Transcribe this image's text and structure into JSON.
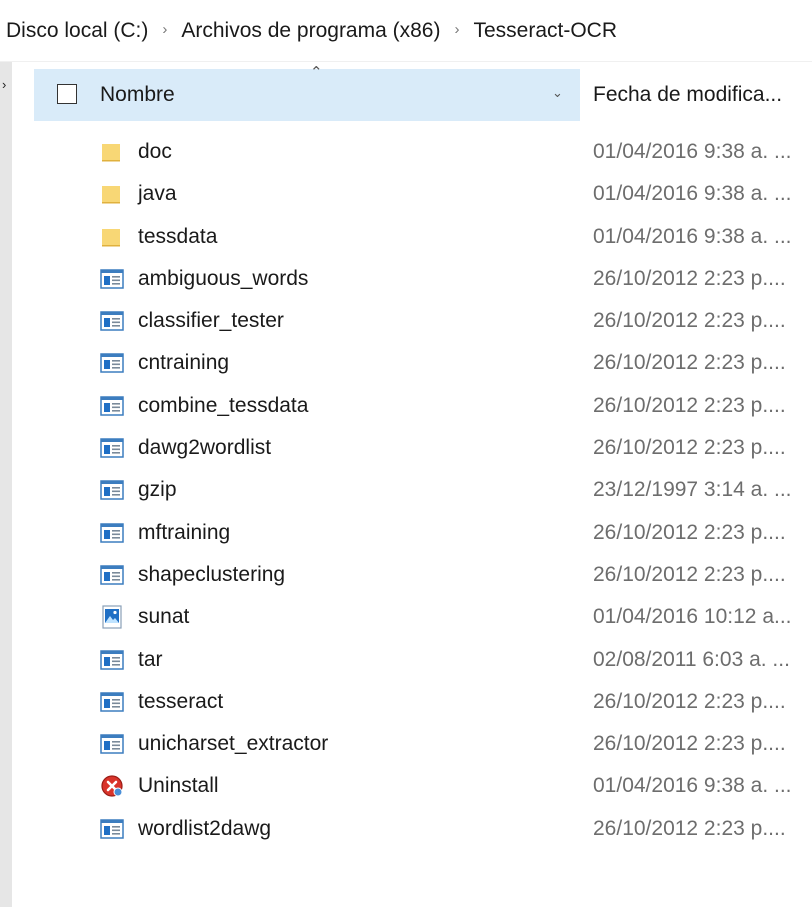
{
  "breadcrumb": {
    "items": [
      "Disco local (C:)",
      "Archivos de programa (x86)",
      "Tesseract-OCR"
    ],
    "separator": "›"
  },
  "columns": {
    "name": "Nombre",
    "date": "Fecha de modifica..."
  },
  "files": [
    {
      "name": "doc",
      "date": "01/04/2016 9:38 a. ...",
      "icon": "folder-icon"
    },
    {
      "name": "java",
      "date": "01/04/2016 9:38 a. ...",
      "icon": "folder-icon"
    },
    {
      "name": "tessdata",
      "date": "01/04/2016 9:38 a. ...",
      "icon": "folder-icon"
    },
    {
      "name": "ambiguous_words",
      "date": "26/10/2012 2:23 p....",
      "icon": "application-icon"
    },
    {
      "name": "classifier_tester",
      "date": "26/10/2012 2:23 p....",
      "icon": "application-icon"
    },
    {
      "name": "cntraining",
      "date": "26/10/2012 2:23 p....",
      "icon": "application-icon"
    },
    {
      "name": "combine_tessdata",
      "date": "26/10/2012 2:23 p....",
      "icon": "application-icon"
    },
    {
      "name": "dawg2wordlist",
      "date": "26/10/2012 2:23 p....",
      "icon": "application-icon"
    },
    {
      "name": "gzip",
      "date": "23/12/1997 3:14 a. ...",
      "icon": "application-icon"
    },
    {
      "name": "mftraining",
      "date": "26/10/2012 2:23 p....",
      "icon": "application-icon"
    },
    {
      "name": "shapeclustering",
      "date": "26/10/2012 2:23 p....",
      "icon": "application-icon"
    },
    {
      "name": "sunat",
      "date": "01/04/2016 10:12 a...",
      "icon": "image-file-icon"
    },
    {
      "name": "tar",
      "date": "02/08/2011 6:03 a. ...",
      "icon": "application-icon"
    },
    {
      "name": "tesseract",
      "date": "26/10/2012 2:23 p....",
      "icon": "application-icon"
    },
    {
      "name": "unicharset_extractor",
      "date": "26/10/2012 2:23 p....",
      "icon": "application-icon"
    },
    {
      "name": "Uninstall",
      "date": "01/04/2016 9:38 a. ...",
      "icon": "uninstall-icon"
    },
    {
      "name": "wordlist2dawg",
      "date": "26/10/2012 2:23 p....",
      "icon": "application-icon"
    }
  ],
  "colors": {
    "header_highlight": "#d9ebf9",
    "folder": "#f8d775",
    "app_icon_blue": "#1f6fc5",
    "date_text": "#6d6d6d"
  }
}
